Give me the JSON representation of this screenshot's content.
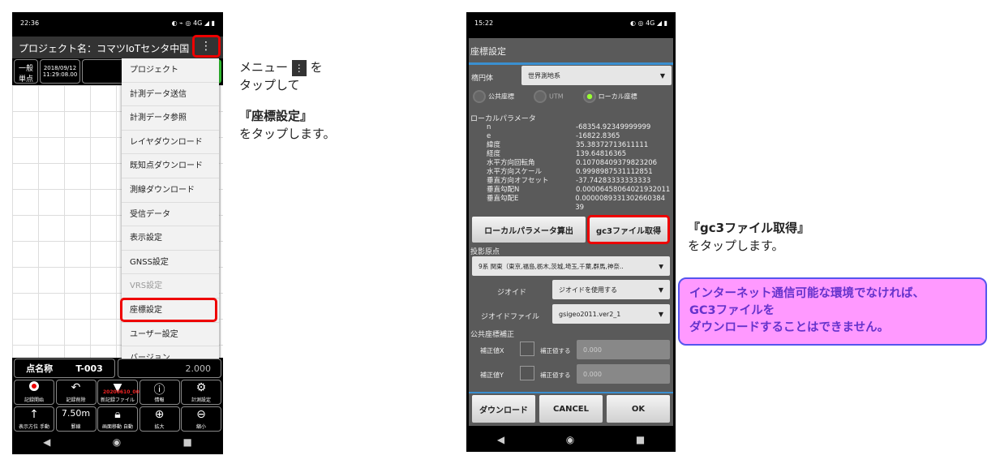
{
  "left_phone": {
    "status_time": "22:36",
    "status_icons": "◐ ⌁ ◎ 4G ◢ ▮",
    "title": "プロジェクト名：コマツIoTセンタ中国",
    "mode": [
      "一般",
      "単点"
    ],
    "datetime": [
      "2018/09/12",
      "11:29:08.00"
    ],
    "menu": [
      "プロジェクト",
      "計測データ送信",
      "計測データ参照",
      "レイヤダウンロード",
      "既知点ダウンロード",
      "測線ダウンロード",
      "受信データ",
      "表示設定",
      "GNSS設定",
      "VRS設定",
      "座標設定",
      "ユーザー設定",
      "バージョン"
    ],
    "point_name_label": "点名称",
    "point_name": "T-003",
    "antenna_value": "2.000",
    "row1": [
      {
        "icon": "record-icon",
        "label": "記録開始"
      },
      {
        "icon": "undo-icon",
        "label": "記録削除"
      },
      {
        "icon": "file-icon",
        "label": "新記録ファイル",
        "overlay": "20200610_001"
      },
      {
        "icon": "info-icon",
        "label": "情報"
      },
      {
        "icon": "gear-icon",
        "label": "計測設定"
      }
    ],
    "row2": [
      {
        "icon": "arrow-up-icon",
        "label": "表示方位 手動"
      },
      {
        "value": "7.50m",
        "label": "罫線"
      },
      {
        "icon": "lock-icon",
        "label": "画面移動 自動"
      },
      {
        "icon": "zoom-in-icon",
        "label": "拡大"
      },
      {
        "icon": "zoom-out-icon",
        "label": "縮小"
      }
    ]
  },
  "left_note": {
    "line1a": "メニュー",
    "line1b": "を",
    "line2": "タップして",
    "line3": "『座標設定』",
    "line4": "をタップします。"
  },
  "right_phone": {
    "status_time": "15:22",
    "status_icons": "◐ ◎ 4G ◢ ▮",
    "dialog_title": "座標設定",
    "ellipsoid_label": "楕円体",
    "ellipsoid_value": "世界測地系",
    "radios": [
      {
        "label": "公共座標",
        "selected": false
      },
      {
        "label": "UTM",
        "selected": false
      },
      {
        "label": "ローカル座標",
        "selected": true
      }
    ],
    "local_params_label": "ローカルパラメータ",
    "params": [
      [
        "n",
        "-68354.92349999999"
      ],
      [
        "e",
        "-16822.8365"
      ],
      [
        "緯度",
        "35.38372713611111"
      ],
      [
        "経度",
        "139.64816365"
      ],
      [
        "水平方向回転角",
        "0.10708409379823206"
      ],
      [
        "水平方向スケール",
        "0.9998987531112851"
      ],
      [
        "垂直方向オフセット",
        "-37.74283333333333"
      ],
      [
        "垂直勾配N",
        "0.000064580640219320​11"
      ],
      [
        "垂直勾配E",
        "0.0000089331302660384​39"
      ]
    ],
    "calc_button": "ローカルパラメータ算出",
    "gc3_button": "gc3ファイル取得",
    "projection_label": "投影原点",
    "projection_value": "9系 関東（東京,福島,栃木,茨城,埼玉,千葉,群馬,神奈..",
    "geoid_label": "ジオイド",
    "geoid_value": "ジオイドを使用する",
    "geoid_file_label": "ジオイドファイル",
    "geoid_file_value": "gsigeo2011.ver2_1",
    "correction_label": "公共座標補正",
    "corr": [
      {
        "label": "補正値X",
        "check": "補正値する",
        "value": "0.000"
      },
      {
        "label": "補正値Y",
        "check": "補正値する",
        "value": "0.000"
      }
    ],
    "download_button": "ダウンロード",
    "cancel_button": "CANCEL",
    "ok_button": "OK"
  },
  "right_note": {
    "line1": "『gc3ファイル取得』",
    "line2": "をタップします。"
  },
  "warning": {
    "line1": "インターネット通信可能な環境でなければ、",
    "line2": "GC3ファイルを",
    "line3": "ダウンロードすることはできません。",
    "color": "#ff99ff",
    "text_color": "#6633cc"
  }
}
